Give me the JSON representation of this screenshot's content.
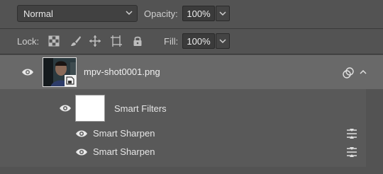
{
  "blend": {
    "mode": "Normal",
    "opacity_label": "Opacity:",
    "opacity_value": "100%"
  },
  "lock": {
    "label": "Lock:",
    "fill_label": "Fill:",
    "fill_value": "100%"
  },
  "layer": {
    "name": "mpv-shot0001.png",
    "visible": true,
    "is_smart_object": true
  },
  "smart_filters": {
    "label": "Smart Filters",
    "visible": true,
    "items": [
      {
        "label": "Smart Sharpen",
        "visible": true
      },
      {
        "label": "Smart Sharpen",
        "visible": true
      }
    ]
  },
  "icons": {
    "blend_dropdown": "chevron-down-icon",
    "lock_transparent": "checkerboard-lock-icon",
    "lock_image": "brush-lock-icon",
    "lock_position": "move-lock-icon",
    "lock_artboard": "artboard-lock-icon",
    "lock_all": "padlock-icon",
    "filter_options": "filter-options-icon",
    "smart_filter_link": "smart-filter-link-icon"
  }
}
